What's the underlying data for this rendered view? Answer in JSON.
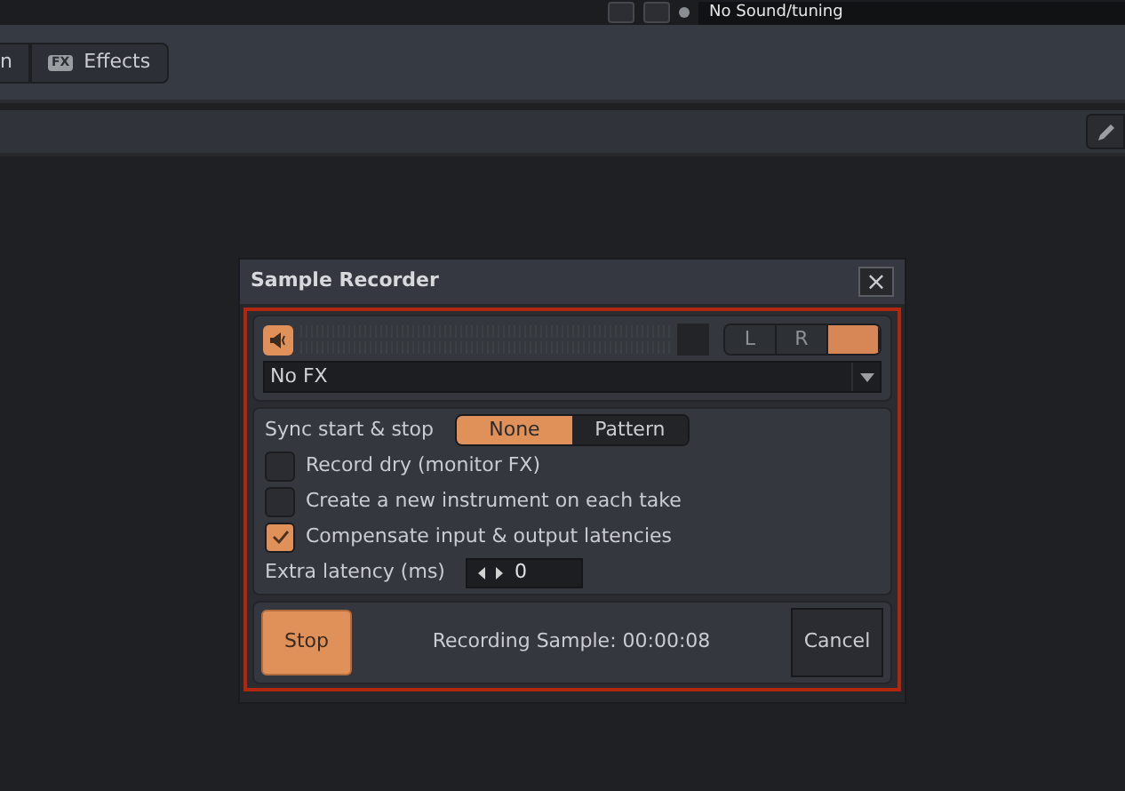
{
  "top_bar": {
    "field_value": "No Sound/tuning"
  },
  "tabs": [
    {
      "label": "n",
      "selected": false
    },
    {
      "label": "Effects",
      "icon": "FX",
      "selected": false
    }
  ],
  "dialog": {
    "title": "Sample Recorder",
    "close": "×",
    "input": {
      "monitor_on": true,
      "level": 0,
      "channel_buttons": [
        {
          "label": "L",
          "selected": false
        },
        {
          "label": "R",
          "selected": false
        },
        {
          "selected": true
        }
      ],
      "fx_select": "No FX"
    },
    "sync": {
      "label": "Sync start & stop",
      "options": [
        {
          "label": "None",
          "selected": true
        },
        {
          "label": "Pattern",
          "selected": false
        }
      ]
    },
    "options": [
      {
        "label": "Record dry (monitor FX)",
        "checked": false
      },
      {
        "label": "Create a new instrument on each take",
        "checked": false
      },
      {
        "label": "Compensate input & output latencies",
        "checked": true
      }
    ],
    "latency": {
      "label": "Extra latency (ms)",
      "value": "0"
    },
    "footer": {
      "stop": "Stop",
      "status": "Recording Sample: 00:00:08",
      "cancel": "Cancel"
    }
  }
}
